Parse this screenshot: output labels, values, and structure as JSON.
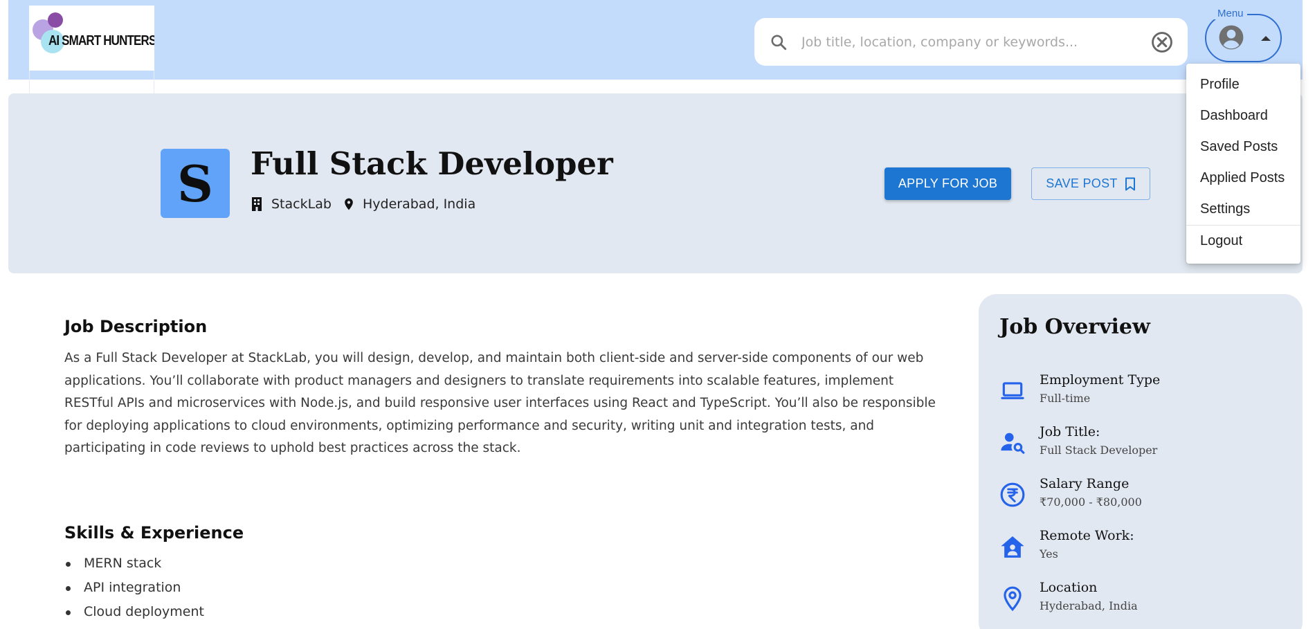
{
  "header": {
    "logo_text": "AI SMART HUNTERS",
    "search_placeholder": "Job title, location, company or keywords...",
    "menu_label": "Menu"
  },
  "menu": {
    "items": [
      "Profile",
      "Dashboard",
      "Saved Posts",
      "Applied Posts",
      "Settings"
    ],
    "logout": "Logout"
  },
  "job": {
    "logo_letter": "S",
    "title": "Full Stack Developer",
    "company": "StackLab",
    "location": "Hyderabad, India",
    "apply_label": "APPLY FOR JOB",
    "save_label": "SAVE POST"
  },
  "description": {
    "heading": "Job Description",
    "text": "As a Full Stack Developer at StackLab, you will design, develop, and maintain both client-side and server-side components of our web applications. You’ll collaborate with product managers and designers to translate requirements into scalable features, implement RESTful APIs and microservices with Node.js, and build responsive user interfaces using React and TypeScript. You’ll also be responsible for deploying applications to cloud environments, optimizing performance and security, writing unit and integration tests, and participating in code reviews to uphold best practices across the stack."
  },
  "skills": {
    "heading": "Skills & Experience",
    "items": [
      "MERN stack",
      "API integration",
      "Cloud deployment"
    ]
  },
  "overview": {
    "heading": "Job Overview",
    "items": [
      {
        "label": "Employment Type",
        "value": "Full-time",
        "icon": "laptop-icon"
      },
      {
        "label": "Job Title:",
        "value": "Full Stack Developer",
        "icon": "person-search-icon"
      },
      {
        "label": "Salary Range",
        "value": "₹70,000 - ₹80,000",
        "icon": "rupee-icon"
      },
      {
        "label": "Remote Work:",
        "value": "Yes",
        "icon": "home-icon"
      },
      {
        "label": "Location",
        "value": "Hyderabad, India",
        "icon": "location-pin-icon"
      }
    ]
  },
  "colors": {
    "header_bg": "#c4dcfc",
    "panel_bg": "#e2e8f1",
    "primary": "#1e76d3",
    "logo_bg": "#61a3f8",
    "icon_blue": "#2563eb"
  }
}
